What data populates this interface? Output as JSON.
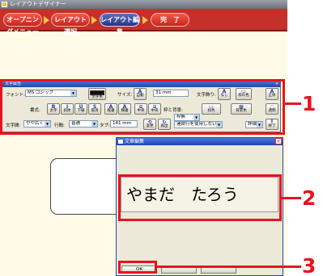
{
  "window": {
    "title": "レイアウトデザイナー"
  },
  "nav": {
    "steps": [
      {
        "label": "オープニングメニュー",
        "state": "done"
      },
      {
        "label": "レイアウト選択",
        "state": "done"
      },
      {
        "label": "レイアウト編集",
        "state": "active"
      },
      {
        "label": "完　了",
        "state": "done"
      }
    ]
  },
  "props_panel": {
    "title": "文字属性",
    "close": "×",
    "font_label": "フォント:",
    "font_value": "MS ゴシック",
    "text_color_label": "文字色",
    "size_label": "サイズ:",
    "size_auto_label": "自動",
    "size_value": "31",
    "size_unit": "mm",
    "frame_label": "文字飾り:",
    "frame_none_label": "なし",
    "frame_color_label": "枠の色",
    "normal_label": "正体",
    "style_label": "書式:",
    "style_buttons": [
      "太字",
      "斜体",
      "下線",
      "取消",
      "縦書",
      "横書",
      "中央",
      "中央"
    ],
    "border_label": "枠と背景:",
    "border_value": "枠無",
    "border_color_label": "枠色",
    "bg_color_label": "背景色",
    "transparent_label": "透明",
    "spacing_label": "文字間:",
    "spacing_value": "やや広く",
    "line_spacing_label": "行間:",
    "line_spacing_value": "普通",
    "tab_label": "タブ:",
    "tab_value": "141",
    "tab_unit": "mm",
    "edit_label": "変更",
    "redraw_label": "再出",
    "linked_value": "連続行を使用しない",
    "detail_label": "詳細",
    "close_label": "終了",
    "text_color": "#111111"
  },
  "dialog": {
    "title": "文章編集",
    "close": "×",
    "text": "やまだ　たろう",
    "ok_label": "OK"
  },
  "callouts": [
    "1",
    "2",
    "3"
  ],
  "colors": {
    "accent": "#e8141e",
    "nav_bar": "#c6302a",
    "active_step": "#27348a"
  }
}
